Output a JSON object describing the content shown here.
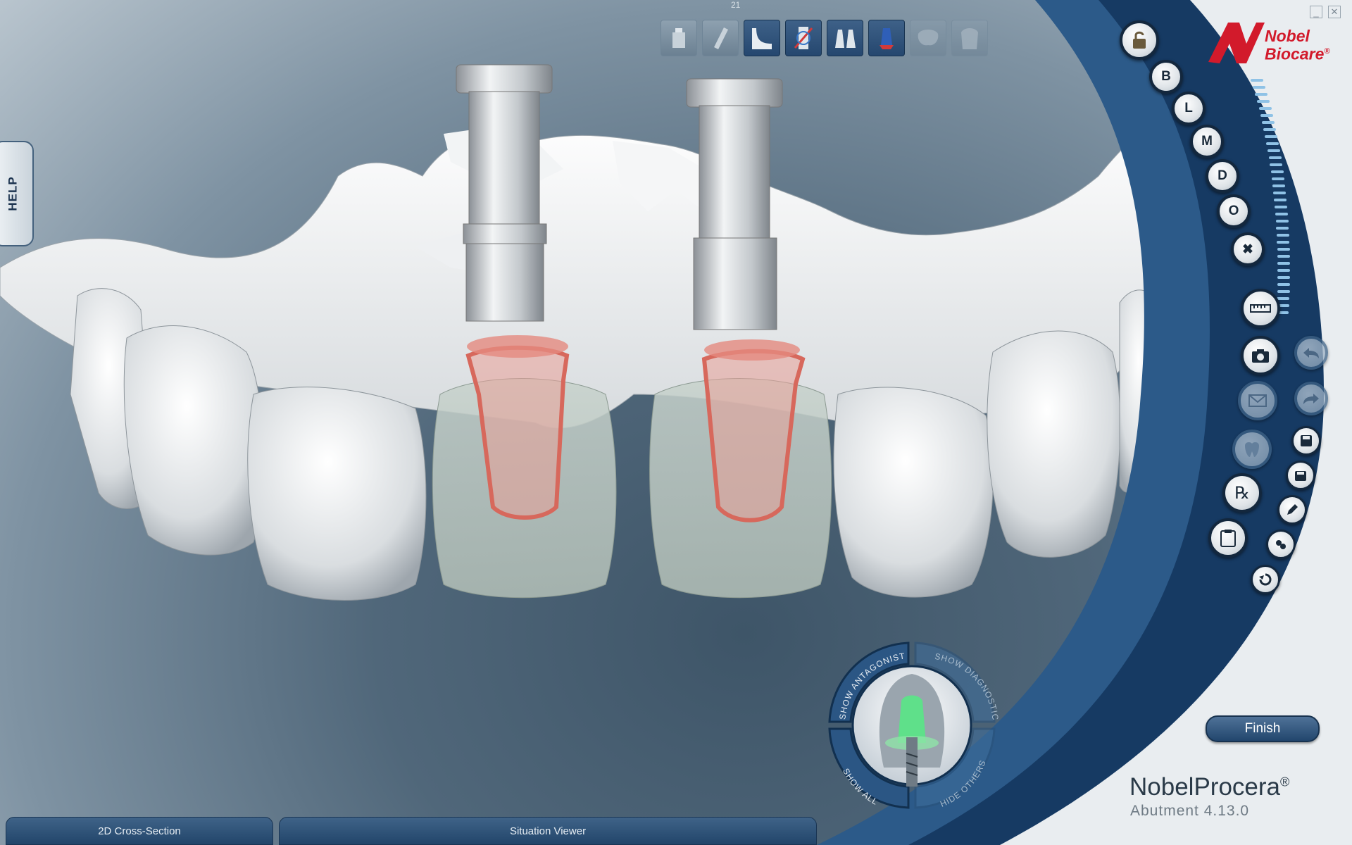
{
  "viewport": {
    "tooth_number": "21"
  },
  "toolbar": {
    "tools": [
      {
        "icon": "implant-icon",
        "state": "normal"
      },
      {
        "icon": "screw-channel-icon",
        "state": "normal"
      },
      {
        "icon": "margin-line-icon",
        "state": "active"
      },
      {
        "icon": "emergence-profile-icon",
        "state": "active"
      },
      {
        "icon": "abutment-pair-icon",
        "state": "active"
      },
      {
        "icon": "abutment-shape-icon",
        "state": "active"
      },
      {
        "icon": "crown-icon",
        "state": "disabled"
      },
      {
        "icon": "coping-icon",
        "state": "disabled"
      }
    ]
  },
  "help_tab": {
    "label": "HELP"
  },
  "right_panel": {
    "view_buttons": [
      "B",
      "L",
      "M",
      "D",
      "O"
    ],
    "colors": {
      "panel_dark": "#163a63",
      "panel_mid": "#2c5a89",
      "panel_light": "#e9edf0",
      "brand_red": "#d21a2b"
    }
  },
  "logo": {
    "line1": "Nobel",
    "line2": "Biocare",
    "mark": "®"
  },
  "finish_button": {
    "label": "Finish"
  },
  "brand": {
    "name": "NobelProcera",
    "mark": "®",
    "subtitle": "Abutment 4.13.0"
  },
  "dial": {
    "show_antagonist": "SHOW ANTAGONIST",
    "show_diagnostic": "SHOW DIAGNOSTIC",
    "show_all": "SHOW ALL",
    "hide_others": "HIDE OTHERS"
  },
  "bottom_tabs": [
    {
      "label": "2D Cross-Section"
    },
    {
      "label": "Situation Viewer"
    }
  ]
}
